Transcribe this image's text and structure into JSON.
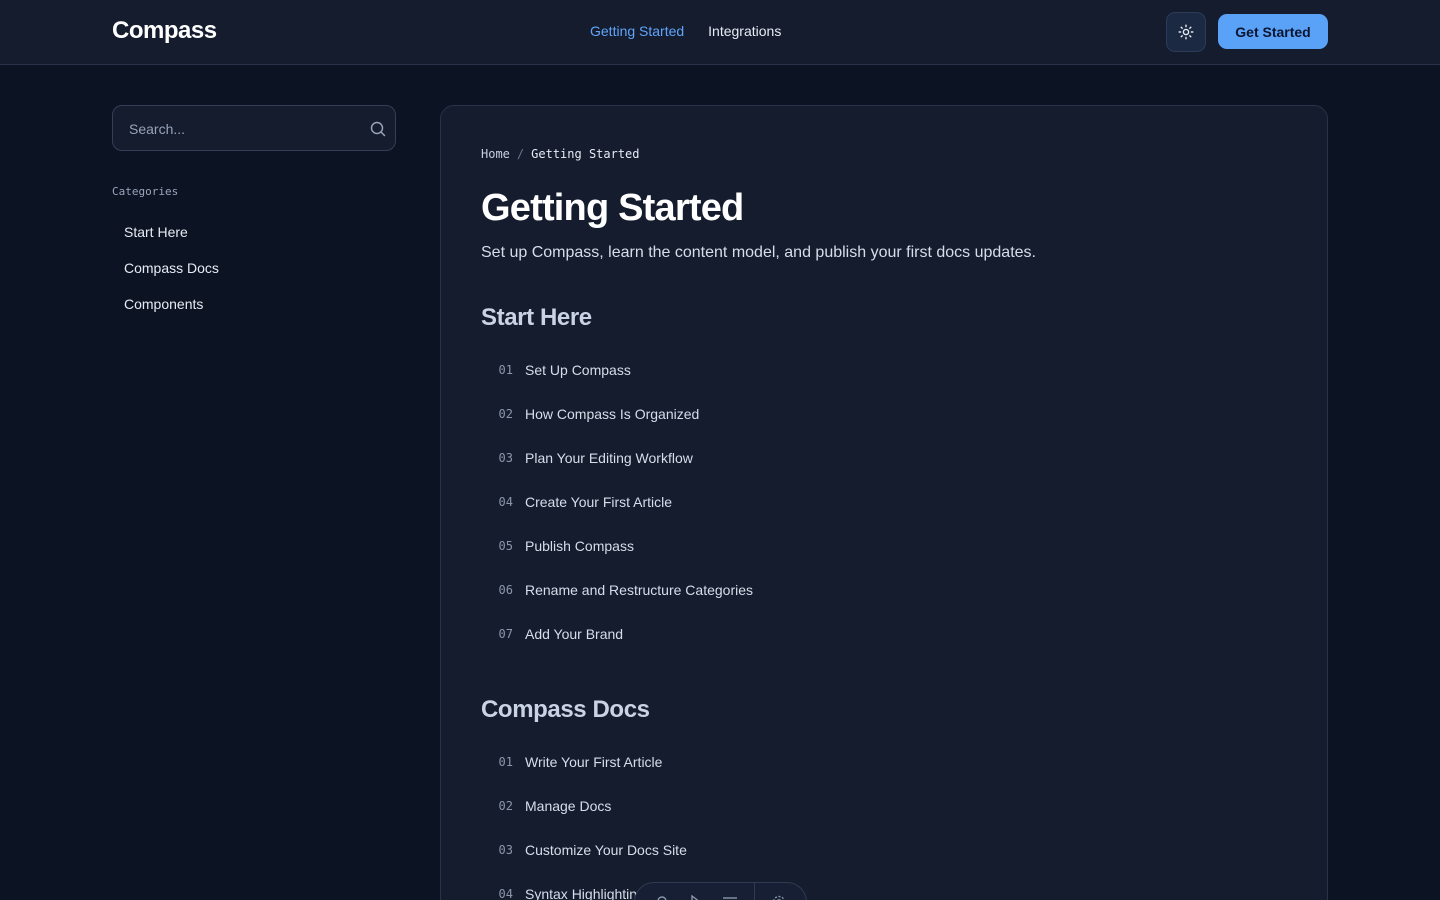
{
  "header": {
    "logo": "Compass",
    "nav": [
      {
        "label": "Getting Started",
        "active": true
      },
      {
        "label": "Integrations",
        "active": false
      }
    ],
    "theme_toggle_icon": "sun-icon",
    "cta_label": "Get Started"
  },
  "sidebar": {
    "search": {
      "placeholder": "Search...",
      "icon": "search-icon"
    },
    "categories_title": "Categories",
    "categories": [
      "Start Here",
      "Compass Docs",
      "Components"
    ]
  },
  "main": {
    "breadcrumb": {
      "home": "Home",
      "separator": "/",
      "current": "Getting Started"
    },
    "title": "Getting Started",
    "lead": "Set up Compass, learn the content model, and publish your first docs updates.",
    "sections": [
      {
        "heading": "Start Here",
        "articles": [
          {
            "num": "01",
            "title": "Set Up Compass"
          },
          {
            "num": "02",
            "title": "How Compass Is Organized"
          },
          {
            "num": "03",
            "title": "Plan Your Editing Workflow"
          },
          {
            "num": "04",
            "title": "Create Your First Article"
          },
          {
            "num": "05",
            "title": "Publish Compass"
          },
          {
            "num": "06",
            "title": "Rename and Restructure Categories"
          },
          {
            "num": "07",
            "title": "Add Your Brand"
          }
        ]
      },
      {
        "heading": "Compass Docs",
        "articles": [
          {
            "num": "01",
            "title": "Write Your First Article"
          },
          {
            "num": "02",
            "title": "Manage Docs"
          },
          {
            "num": "03",
            "title": "Customize Your Docs Site"
          },
          {
            "num": "04",
            "title": "Syntax Highlighting"
          }
        ]
      }
    ]
  },
  "floating_toolbar": {
    "icons": [
      "bell-icon",
      "pointer-icon",
      "menu-icon",
      "settings-icon"
    ]
  },
  "colors": {
    "accent": "#60a5fa",
    "cta": "#5aa2f8",
    "background": "#0c1322",
    "surface": "#141c2e"
  }
}
